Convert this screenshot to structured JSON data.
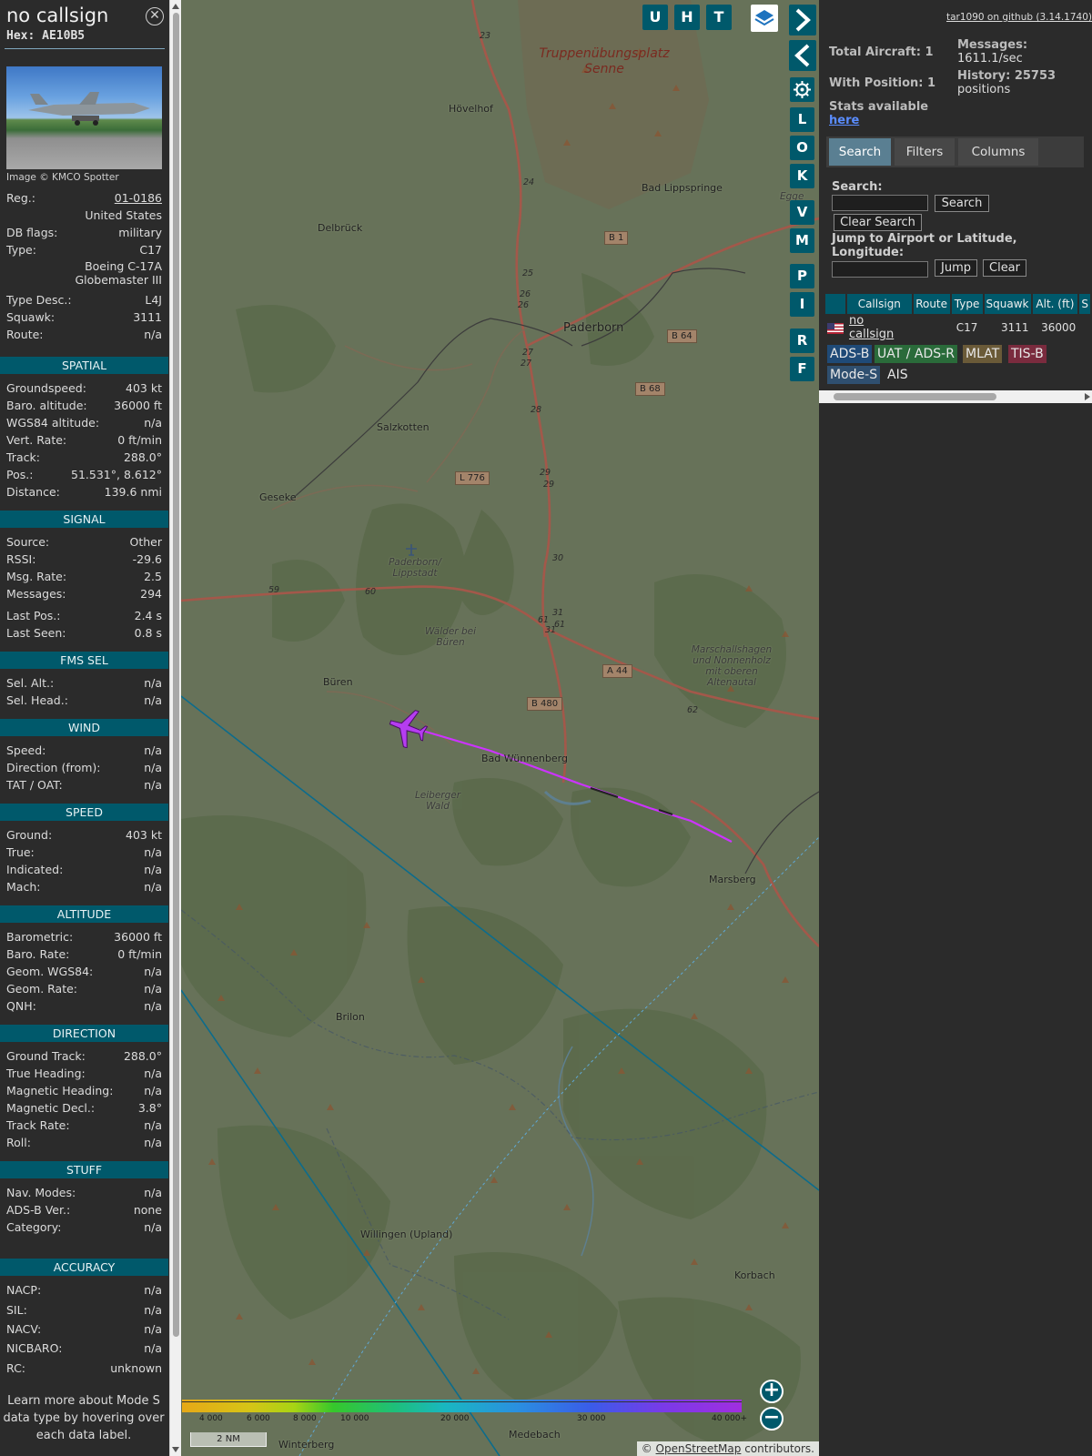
{
  "info": {
    "callsign": "no callsign",
    "hex": "Hex: AE10B5",
    "photo_credit": "Image © KMCO Spotter",
    "rows_top": [
      {
        "label": "Reg.:",
        "value": "01-0186",
        "link": true
      },
      {
        "label": "",
        "value": "United States"
      },
      {
        "label": "DB flags:",
        "value": "military"
      },
      {
        "label": "Type:",
        "value": "C17"
      },
      {
        "label": "",
        "value": "Boeing C-17A Globemaster III",
        "multi": true
      },
      {
        "label": "Type Desc.:",
        "value": "L4J"
      },
      {
        "label": "Squawk:",
        "value": "3111"
      },
      {
        "label": "Route:",
        "value": "n/a"
      }
    ],
    "sections": {
      "spatial": {
        "title": "SPATIAL",
        "rows": [
          {
            "label": "Groundspeed:",
            "value": "403 kt"
          },
          {
            "label": "Baro. altitude:",
            "value": "36000 ft"
          },
          {
            "label": "WGS84 altitude:",
            "value": "n/a"
          },
          {
            "label": "Vert. Rate:",
            "value": "0 ft/min"
          },
          {
            "label": "Track:",
            "value": "288.0°"
          },
          {
            "label": "Pos.:",
            "value": "51.531°, 8.612°"
          },
          {
            "label": "Distance:",
            "value": "139.6 nmi"
          }
        ]
      },
      "signal": {
        "title": "SIGNAL",
        "rows": [
          {
            "label": "Source:",
            "value": "Other"
          },
          {
            "label": "RSSI:",
            "value": "-29.6"
          },
          {
            "label": "Msg. Rate:",
            "value": "2.5"
          },
          {
            "label": "Messages:",
            "value": "294"
          },
          {
            "label": "Last Pos.:",
            "value": "2.4 s"
          },
          {
            "label": "Last Seen:",
            "value": "0.8 s"
          }
        ]
      },
      "fms": {
        "title": "FMS SEL",
        "rows": [
          {
            "label": "Sel. Alt.:",
            "value": "n/a"
          },
          {
            "label": "Sel. Head.:",
            "value": "n/a"
          }
        ]
      },
      "wind": {
        "title": "WIND",
        "rows": [
          {
            "label": "Speed:",
            "value": "n/a"
          },
          {
            "label": "Direction (from):",
            "value": "n/a"
          },
          {
            "label": "TAT / OAT:",
            "value": "n/a"
          }
        ]
      },
      "speed": {
        "title": "SPEED",
        "rows": [
          {
            "label": "Ground:",
            "value": "403 kt"
          },
          {
            "label": "True:",
            "value": "n/a"
          },
          {
            "label": "Indicated:",
            "value": "n/a"
          },
          {
            "label": "Mach:",
            "value": "n/a"
          }
        ]
      },
      "altitude": {
        "title": "ALTITUDE",
        "rows": [
          {
            "label": "Barometric:",
            "value": "36000 ft"
          },
          {
            "label": "Baro. Rate:",
            "value": "0 ft/min"
          },
          {
            "label": "Geom. WGS84:",
            "value": "n/a"
          },
          {
            "label": "Geom. Rate:",
            "value": "n/a"
          },
          {
            "label": "QNH:",
            "value": "n/a"
          }
        ]
      },
      "direction": {
        "title": "DIRECTION",
        "rows": [
          {
            "label": "Ground Track:",
            "value": "288.0°"
          },
          {
            "label": "True Heading:",
            "value": "n/a"
          },
          {
            "label": "Magnetic Heading:",
            "value": "n/a"
          },
          {
            "label": "Magnetic Decl.:",
            "value": "3.8°"
          },
          {
            "label": "Track Rate:",
            "value": "n/a"
          },
          {
            "label": "Roll:",
            "value": "n/a"
          }
        ]
      },
      "stuff": {
        "title": "STUFF",
        "rows": [
          {
            "label": "Nav. Modes:",
            "value": "n/a"
          },
          {
            "label": "ADS-B Ver.:",
            "value": "none"
          },
          {
            "label": "Category:",
            "value": "n/a"
          }
        ]
      },
      "accuracy": {
        "title": "ACCURACY",
        "rows": [
          {
            "label": "NACP:",
            "value": "n/a"
          },
          {
            "label": "SIL:",
            "value": "n/a"
          },
          {
            "label": "NACV:",
            "value": "n/a"
          },
          {
            "label": "NICBARO:",
            "value": "n/a"
          },
          {
            "label": "RC:",
            "value": "unknown"
          }
        ]
      }
    },
    "learn_more": "Learn more about Mode S data type by hovering over each data label."
  },
  "map": {
    "top_buttons": [
      "U",
      "H",
      "T"
    ],
    "side_buttons": [
      "L",
      "O",
      "K",
      "V",
      "M",
      "P",
      "I",
      "R",
      "F"
    ],
    "places": [
      {
        "name": "Hövelhof",
        "cls": ""
      },
      {
        "name": "Delbrück",
        "cls": ""
      },
      {
        "name": "Bad Lippspringe",
        "cls": ""
      },
      {
        "name": "Paderborn",
        "cls": "big"
      },
      {
        "name": "Salzkotten",
        "cls": ""
      },
      {
        "name": "Geseke",
        "cls": ""
      },
      {
        "name": "Büren",
        "cls": ""
      },
      {
        "name": "Bad Wünnenberg",
        "cls": ""
      },
      {
        "name": "Marsberg",
        "cls": ""
      },
      {
        "name": "Brilon",
        "cls": ""
      },
      {
        "name": "Willingen (Upland)",
        "cls": ""
      },
      {
        "name": "Korbach",
        "cls": ""
      },
      {
        "name": "Winterberg",
        "cls": ""
      },
      {
        "name": "Medebach",
        "cls": ""
      },
      {
        "name": "Egge",
        "cls": "italic"
      }
    ],
    "forests": [
      "Paderborn/ Lippstadt",
      "Wälder bei Büren",
      "Leiberger Wald",
      "Marschallshagen und Nonnenholz mit oberen Altenautal"
    ],
    "military_area": "Truppenübungsplatz Senne",
    "road_shields": [
      "B 1",
      "B 64",
      "B 68",
      "L 776",
      "A 44",
      "B 480"
    ],
    "road_km": [
      "23",
      "24",
      "25",
      "26",
      "26",
      "27",
      "27",
      "28",
      "29",
      "29",
      "30",
      "31",
      "31",
      "61",
      "61",
      "59",
      "60",
      "62"
    ],
    "colorbar_labels": [
      "4 000",
      "6 000",
      "8 000",
      "10 000",
      "20 000",
      "30 000",
      "40 000+"
    ],
    "scale": "2 NM",
    "attribution_prefix": "© ",
    "attribution_link": "OpenStreetMap",
    "attribution_suffix": " contributors."
  },
  "right": {
    "github": "tar1090 on github (3.14.1740)",
    "total_aircraft": "Total Aircraft: 1",
    "with_position": "With Position: 1",
    "stats_label": "Stats available",
    "stats_link": "here",
    "messages_label": "Messages:",
    "messages_value": "1611.1/sec",
    "history_label": "History: 25753",
    "history_value": "positions",
    "tabs": [
      "Search",
      "Filters",
      "Columns"
    ],
    "search_label": "Search:",
    "search_button": "Search",
    "clear_search_button": "Clear Search",
    "jump_label": "Jump to Airport or Latitude, Longitude:",
    "jump_button": "Jump",
    "clear_button": "Clear",
    "table_headers": [
      "",
      "Callsign",
      "Route",
      "Type",
      "Squawk",
      "Alt. (ft)",
      "S"
    ],
    "table_rows": [
      {
        "callsign": "no callsign",
        "route": "",
        "type": "C17",
        "squawk": "3111",
        "alt": "36000"
      }
    ],
    "legend": [
      {
        "label": "ADS-B",
        "bg": "#1f4a77"
      },
      {
        "label": "UAT / ADS-R",
        "bg": "#2a6b3a"
      },
      {
        "label": "MLAT",
        "bg": "#6a5a38"
      },
      {
        "label": "TIS-B",
        "bg": "#7a2b3e"
      },
      {
        "label": "Mode-S",
        "bg": "#2f4f6f"
      },
      {
        "label": "AIS",
        "bg": ""
      }
    ]
  }
}
